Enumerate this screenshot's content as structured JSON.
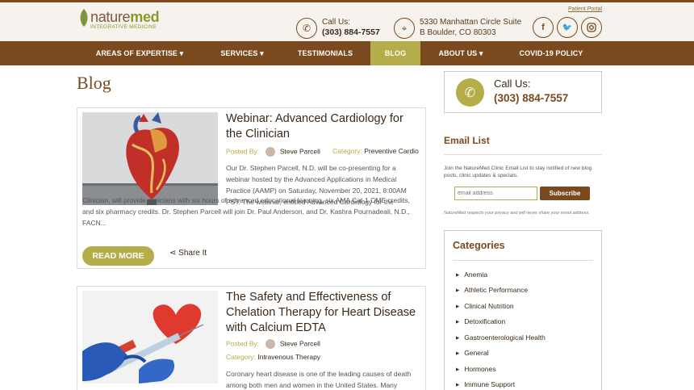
{
  "header": {
    "logo_name_a": "nature",
    "logo_name_b": "med",
    "logo_sub": "INTEGRATIVE MEDICINE",
    "call_label": "Call Us:",
    "call_number": "(303) 884-7557",
    "address_line1": "5330 Manhattan Circle Suite",
    "address_line2": "B Boulder, CO 80303",
    "patient_portal": "Patient Portal",
    "social": [
      "facebook-icon",
      "twitter-icon",
      "instagram-icon"
    ]
  },
  "nav": {
    "items": [
      {
        "label": "AREAS OF EXPERTISE ▾"
      },
      {
        "label": "SERVICES ▾"
      },
      {
        "label": "TESTIMONIALS"
      },
      {
        "label": "BLOG"
      },
      {
        "label": "ABOUT US ▾"
      },
      {
        "label": "COVID-19 POLICY"
      }
    ],
    "active": "BLOG"
  },
  "main": {
    "page_title": "Blog",
    "posts": [
      {
        "title": "Webinar: Advanced Cardiology for the Clinician",
        "posted_by_label": "Posted By:",
        "author": "Steve Parcell",
        "category_label": "Category:",
        "category": "Preventive Cardio",
        "excerpt_top": "Our Dr. Stephen Parcell, N.D. will be co-presenting for a webinar hosted by the Advanced Applications in Medical Practice (AAMP) on Saturday, November 20, 2021, 8:00AM PST. The webinar, entitled Advanced Cardiology for the",
        "excerpt_bottom": "Clinician, will provide clinicians with six hours of advanced educational learning, six AMA Cat-1 CME credits, and six pharmacy credits. Dr. Stephen Parcell will join Dr. Paul Anderson, and Dr. Kashra Pournadeali, N.D., FACN...",
        "read_more": "READ MORE",
        "share": "Share It"
      },
      {
        "title": "The Safety and Effectiveness of Chelation Therapy for Heart Disease with Calcium EDTA",
        "posted_by_label": "Posted By:",
        "author": "Steve Parcell",
        "category_label": "Category:",
        "category": "Intravenous Therapy",
        "excerpt_top": "Coronary heart disease is one of the leading causes of death among both men and women in the United States. Many"
      }
    ]
  },
  "sidebar": {
    "call_label": "Call Us:",
    "call_number": "(303) 884-7557",
    "email_title": "Email List",
    "email_desc": "Join the NatureMed Clinic Email List to stay notified of new blog posts, clinic updates & specials.",
    "email_placeholder": "email address",
    "subscribe": "Subscribe",
    "privacy": "NatureMed respects your privacy and will never share your email address.",
    "categories_title": "Categories",
    "categories": [
      "Anemia",
      "Athletic Performance",
      "Clinical Nutrition",
      "Detoxification",
      "Gastroenterological Health",
      "General",
      "Hormones",
      "Immune Support"
    ]
  },
  "colors": {
    "brown": "#7a4a1e",
    "olive": "#b5ad4a"
  }
}
